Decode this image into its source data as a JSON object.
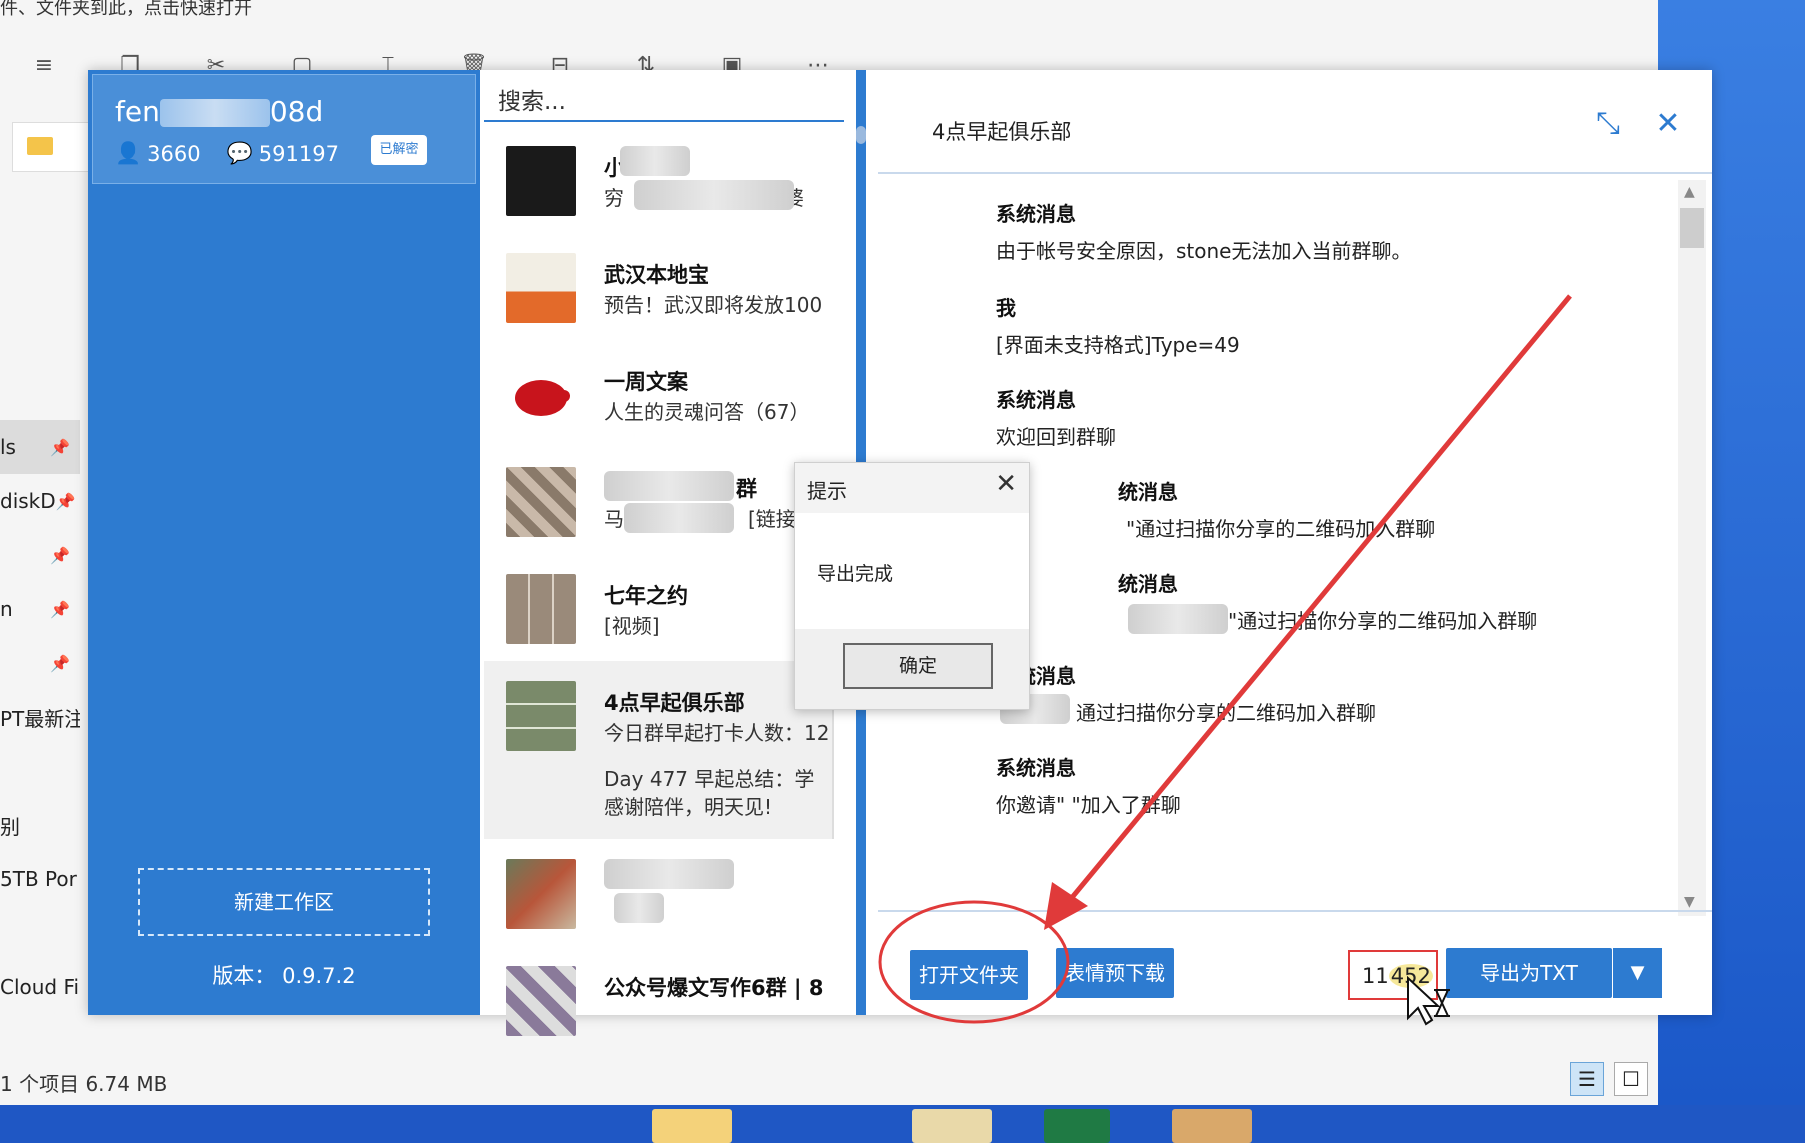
{
  "explorer": {
    "hint_text": "件、文件夹到此，点击快速打开",
    "nav_items": [
      "ls",
      "diskD",
      "",
      "n",
      "",
      "PT最新注",
      "",
      "别",
      "5TB Por",
      "",
      "Cloud Fil"
    ],
    "status": "1 个项目   6.74 MB"
  },
  "account": {
    "name_prefix": "fen",
    "name_suffix": "08d",
    "contacts": "3660",
    "messages": "591197",
    "badge": "已解密"
  },
  "left_panel": {
    "new_workspace": "新建工作区",
    "version": "版本：  0.9.7.2"
  },
  "chat_list": {
    "search_placeholder": "搜索...",
    "items": [
      {
        "title": "小",
        "sub": "穷",
        "sub_tail": "老婆",
        "avatar_color": "#1a1a1a"
      },
      {
        "title": "武汉本地宝",
        "sub": "预告！武汉即将发放100",
        "avatar_color": "#e8e0d0"
      },
      {
        "title": "一周文案",
        "sub": "人生的灵魂问答（67）",
        "avatar_color": "#ffffff"
      },
      {
        "title": "群",
        "sub": "马",
        "sub_tail": "[链接",
        "avatar_color": "#8a7a6a"
      },
      {
        "title": "七年之约",
        "sub": "[视频]",
        "avatar_color": "#9a8a7a"
      },
      {
        "title": "4点早起俱乐部",
        "sub": "今日群早起打卡人数：12",
        "sub2a": "Day 477   早起总结：学",
        "sub2b": "感谢陪伴，明天见!",
        "avatar_color": "#7a8a6a"
      },
      {
        "title": "",
        "sub": "",
        "avatar_color": "#6a7a5a"
      },
      {
        "title": "公众号爆文写作6群 | 8",
        "sub": "",
        "avatar_color": "#8a7a9a"
      }
    ]
  },
  "messages": {
    "title": "4点早起俱乐部",
    "items": [
      {
        "sender": "系统消息",
        "text": "由于帐号安全原因，stone无法加入当前群聊。"
      },
      {
        "sender": "我",
        "text": "[界面未支持格式]Type=49"
      },
      {
        "sender": "系统消息",
        "text": "欢迎回到群聊"
      },
      {
        "sender": "统消息",
        "text": "\"通过扫描你分享的二维码加入群聊"
      },
      {
        "sender": "统消息",
        "text": "\"通过扫描你分享的二维码加入群聊"
      },
      {
        "sender": "系统消息",
        "text": "通过扫描你分享的二维码加入群聊"
      },
      {
        "sender": "系统消息",
        "text": "你邀请\"      \"加入了群聊"
      }
    ],
    "open_folder": "打开文件夹",
    "emoji_download": "表情预下载",
    "count_prefix": "11",
    "count_highlight": "452",
    "export_txt": "导出为TXT",
    "dropdown_glyph": "▼"
  },
  "dialog": {
    "title": "提示",
    "message": "导出完成",
    "ok": "确定",
    "close_glyph": "✕"
  },
  "colors": {
    "accent": "#2d7bd0",
    "annotation": "#e03a3a"
  }
}
